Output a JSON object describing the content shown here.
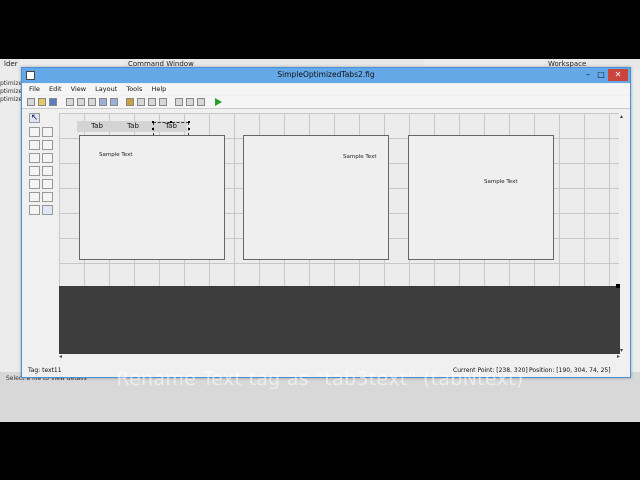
{
  "background": {
    "left_panel_title": "lder",
    "left_panel_items": [
      "ptimize",
      "ptimize",
      "ptimize"
    ],
    "command_window_title": "Command Window",
    "workspace_title": "Workspace",
    "status_text": "Select a file to view details"
  },
  "window": {
    "title": "SimpleOptimizedTabs2.fig",
    "controls": {
      "minimize": "–",
      "maximize": "□",
      "close": "✕"
    }
  },
  "menu": [
    "File",
    "Edit",
    "View",
    "Layout",
    "Tools",
    "Help"
  ],
  "toolbar_icons": [
    "new-icon",
    "open-icon",
    "save-icon",
    "cut-icon",
    "copy-icon",
    "paste-icon",
    "undo-icon",
    "redo-icon",
    "align-icon",
    "menu-editor-icon",
    "tab-order-icon",
    "toolbar-editor-icon",
    "editor-icon",
    "inspector-icon",
    "object-browser-icon",
    "run-icon"
  ],
  "palette": {
    "select_glyph": "↖",
    "icons": [
      "pushbutton-icon",
      "slider-icon",
      "radiobutton-icon",
      "checkbox-icon",
      "edit-text-icon",
      "static-text-icon",
      "popup-menu-icon",
      "listbox-icon",
      "toggle-button-icon",
      "table-icon",
      "axes-icon",
      "panel-icon",
      "button-group-icon",
      "activex-icon"
    ]
  },
  "tabs": [
    "Tab",
    "Tab",
    "Tab"
  ],
  "panels": [
    {
      "sample_text": "Sample Text"
    },
    {
      "sample_text": "Sample Text"
    },
    {
      "sample_text": "Sample Text"
    }
  ],
  "status": {
    "tag": "Tag: text11",
    "current_point": "Current Point:  [238, 320]",
    "position": "Position:  [190, 304, 74, 25]"
  },
  "caption": "Rename Text tag as \"tab3text\" (tabNtext)",
  "colors": {
    "title_bar": "#64a8e8",
    "dark_area": "#3c3c3c",
    "run": "#2a9d2a"
  }
}
